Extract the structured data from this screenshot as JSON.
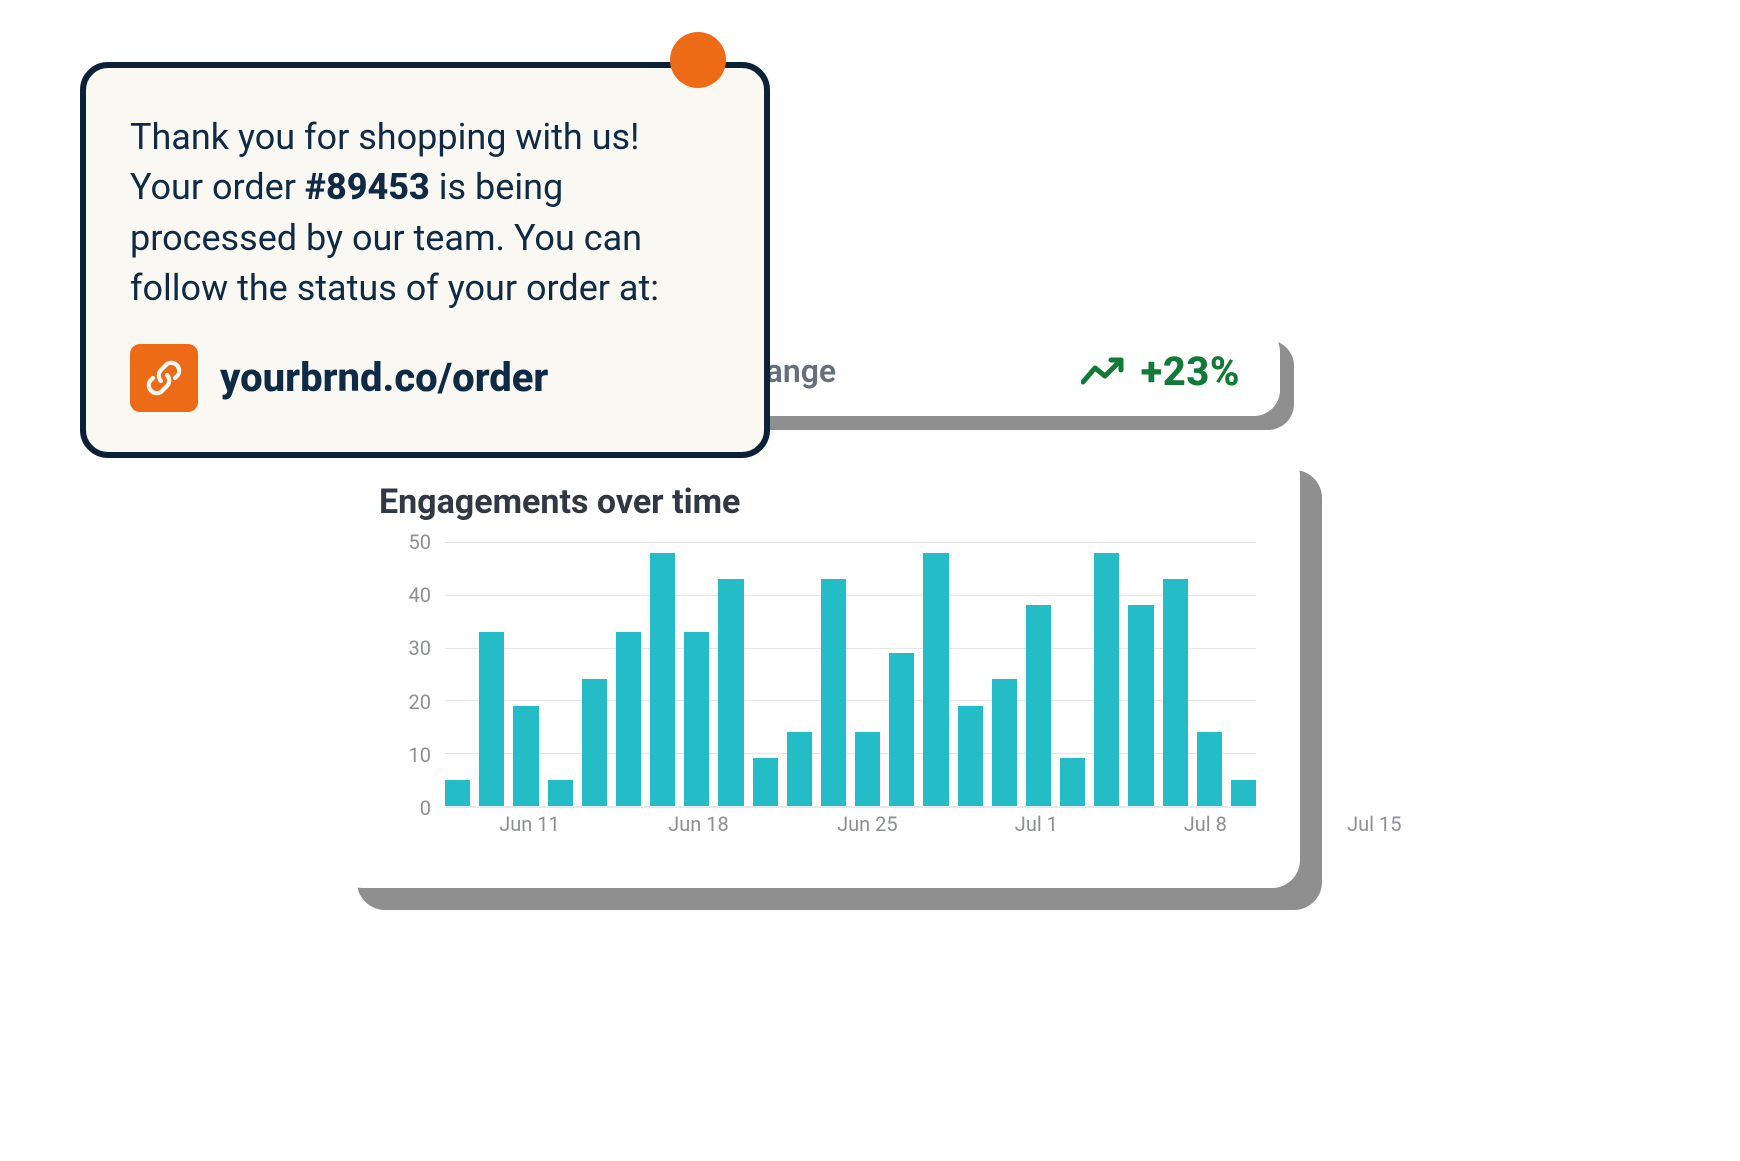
{
  "message": {
    "body_prefix": "Thank you for shopping with us! Your order ",
    "order_number": "#89453",
    "body_suffix": " is being processed by our team. You can follow the status of your order at:",
    "link_url_display": "yourbrnd.co/order"
  },
  "weekly_change": {
    "label": "Weekly change",
    "value": "+23%"
  },
  "chart": {
    "title": "Engagements over time"
  },
  "chart_data": {
    "type": "bar",
    "title": "Engagements over time",
    "xlabel": "",
    "ylabel": "",
    "ylim": [
      0,
      50
    ],
    "y_ticks": [
      0,
      10,
      20,
      30,
      40,
      50
    ],
    "x_tick_labels": [
      "Jun 11",
      "Jun 18",
      "Jun 25",
      "Jul 1",
      "Jul 8",
      "Jul 15"
    ],
    "x_tick_positions": [
      2,
      7,
      12,
      17,
      22,
      27
    ],
    "values": [
      5,
      33,
      19,
      5,
      24,
      33,
      48,
      33,
      43,
      9,
      14,
      43,
      14,
      29,
      48,
      19,
      24,
      38,
      9,
      48,
      38,
      43,
      14,
      5
    ]
  },
  "colors": {
    "navy": "#0e2a44",
    "cream": "#faf8f2",
    "orange": "#ed6b17",
    "green": "#107a36",
    "teal": "#24bcc6"
  }
}
